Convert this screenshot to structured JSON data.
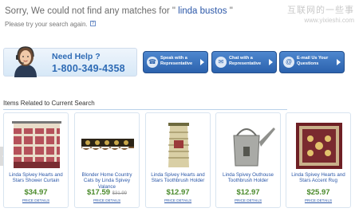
{
  "message": {
    "sorry_prefix": "Sorry, We could not find any matches for \"",
    "query": " linda bustos ",
    "sorry_suffix": "\"",
    "try_again": "Please try your search again.",
    "hint_icon_label": "?"
  },
  "watermark": {
    "chinese": "互联网的一些事",
    "url": "www.yixieshi.com"
  },
  "help": {
    "title": "Need Help ?",
    "phone": "1-800-349-4358"
  },
  "contact_buttons": [
    {
      "label": "Speak with a Representative",
      "icon": "phone-icon"
    },
    {
      "label": "Chat with a Representative",
      "icon": "chat-icon"
    },
    {
      "label": "E-mail Us Your Questions",
      "icon": "email-icon"
    }
  ],
  "related": {
    "heading": "Items Related to Current Search",
    "products": [
      {
        "name": "Linda Spivey Hearts and Stars Shower Curtain",
        "price": "$34.97",
        "old_price": "",
        "details": "PRICE DETAILS"
      },
      {
        "name": "Blonder Home Country Cats by Linda Spivey Valance",
        "price": "$17.59",
        "old_price": "$31.99",
        "details": "PRICE DETAILS"
      },
      {
        "name": "Linda Spivey Hearts and Stars Toothbrush Holder",
        "price": "$12.97",
        "old_price": "",
        "details": "PRICE DETAILS"
      },
      {
        "name": "Linda Spivey Outhouse Toothbrush Holder",
        "price": "$12.97",
        "old_price": "",
        "details": "PRICE DETAILS"
      },
      {
        "name": "Linda Spivey Hearts and Stars Accent Rug",
        "price": "$25.97",
        "old_price": "",
        "details": "PRICE DETAILS"
      }
    ]
  }
}
